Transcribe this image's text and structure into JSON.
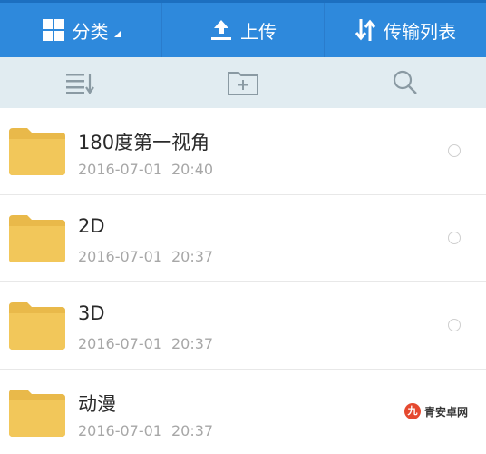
{
  "topbar": {
    "tabs": [
      {
        "label": "分类",
        "icon": "grid-icon"
      },
      {
        "label": "上传",
        "icon": "upload-icon"
      },
      {
        "label": "传输列表",
        "icon": "transfer-icon"
      }
    ]
  },
  "toolbar": {
    "icons": [
      "sort-list-icon",
      "new-folder-icon",
      "search-icon"
    ]
  },
  "files": [
    {
      "name": "180度第一视角",
      "date": "2016-07-01",
      "time": "20:40"
    },
    {
      "name": "2D",
      "date": "2016-07-01",
      "time": "20:37"
    },
    {
      "name": "3D",
      "date": "2016-07-01",
      "time": "20:37"
    },
    {
      "name": "动漫",
      "date": "2016-07-01",
      "time": "20:37"
    }
  ],
  "watermark": {
    "mark": "九",
    "text": "青安卓网"
  },
  "colors": {
    "accent": "#2e89dc",
    "toolbar_bg": "#e1ecf1",
    "folder": "#f2c75a"
  }
}
